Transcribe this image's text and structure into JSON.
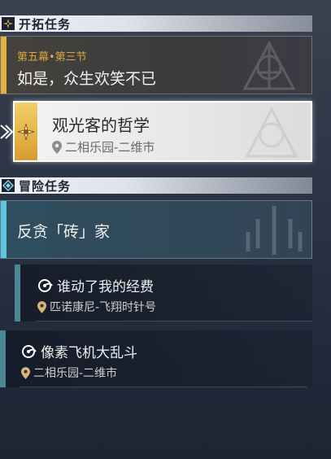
{
  "sections": {
    "trailblaze": {
      "label": "开拓任务"
    },
    "adventure": {
      "label": "冒险任务"
    }
  },
  "trailblaze_quests": [
    {
      "subtitle": "第五幕•第三节",
      "title": "如是，众生欢笑不已"
    },
    {
      "title": "观光客的哲学",
      "location": "二相乐园-二维市"
    }
  ],
  "adventure_quests": [
    {
      "title": "反贪「砖」家"
    },
    {
      "title": "谁动了我的经费",
      "location": "匹诺康尼-飞翔时针号"
    },
    {
      "title": "像素飞机大乱斗",
      "location": "二相乐园-二维市"
    }
  ],
  "colors": {
    "trailblaze_accent": "#e0b340",
    "adventure_accent": "#5ec8e0",
    "sub_accent": "#4c8796"
  },
  "icons": {
    "trailblaze_header": "compass-star-icon",
    "adventure_header": "diamond-star-icon",
    "location": "location-pin-icon",
    "quest_type": "spiral-icon"
  }
}
